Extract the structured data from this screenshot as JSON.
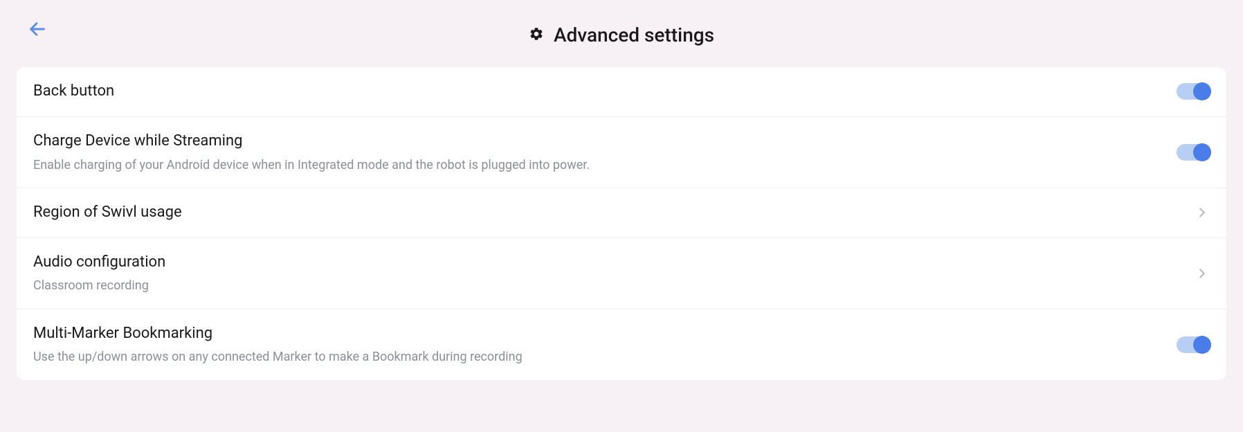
{
  "header": {
    "title": "Advanced settings"
  },
  "settings": [
    {
      "title": "Back button",
      "subtitle": null,
      "type": "toggle",
      "value": true
    },
    {
      "title": "Charge Device while Streaming",
      "subtitle": "Enable charging of your Android device when in Integrated mode and the robot is plugged into power.",
      "type": "toggle",
      "value": true
    },
    {
      "title": "Region of Swivl usage",
      "subtitle": null,
      "type": "nav",
      "value": null
    },
    {
      "title": "Audio configuration",
      "subtitle": "Classroom recording",
      "type": "nav",
      "value": null
    },
    {
      "title": "Multi-Marker Bookmarking",
      "subtitle": "Use the up/down arrows on any connected Marker to make a Bookmark during recording",
      "type": "toggle",
      "value": true
    }
  ]
}
